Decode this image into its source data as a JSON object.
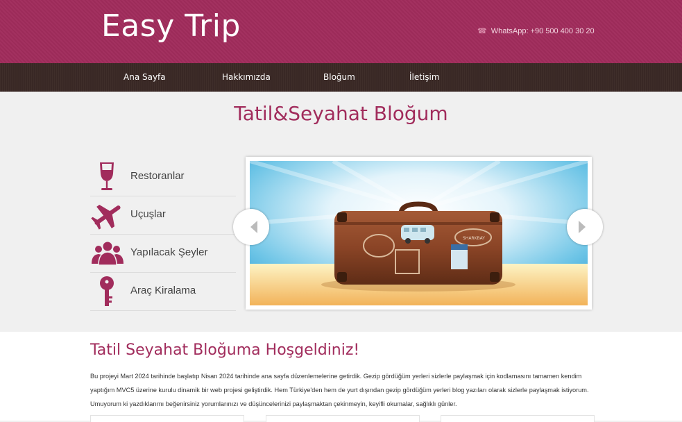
{
  "header": {
    "logo": "Easy Trip",
    "whatsapp_icon": "phone-icon",
    "whatsapp": "WhatsApp: +90 500 400 30 20"
  },
  "nav": {
    "items": [
      {
        "label": "Ana Sayfa"
      },
      {
        "label": "Hakkımızda"
      },
      {
        "label": "Bloğum"
      },
      {
        "label": "İletişim"
      }
    ]
  },
  "hero": {
    "title": "Tatil&Seyahat Bloğum"
  },
  "categories": [
    {
      "label": "Restoranlar",
      "icon": "wine-glass-icon"
    },
    {
      "label": "Uçuşlar",
      "icon": "airplane-icon"
    },
    {
      "label": "Yapılacak Şeyler",
      "icon": "people-icon"
    },
    {
      "label": "Araç Kiralama",
      "icon": "key-icon"
    }
  ],
  "slider": {
    "image": "vintage-suitcase-on-beach",
    "suitcase_sticker": "SHARKBAY",
    "prev_icon": "chevron-left-icon",
    "next_icon": "chevron-right-icon"
  },
  "welcome": {
    "title": "Tatil Seyahat Bloğuma Hoşgeldiniz!",
    "text": "Bu projeyi Mart 2024 tarihinde başlatıp Nisan 2024 tarihinde ana sayfa düzenlemelerine getirdik. Gezip gördüğüm yerleri sizlerle paylaşmak için kodlamasını tamamen kendim yaptığım MVC5 üzerine kurulu dinamik bir web projesi geliştirdik. Hem Türkiye'den hem de yurt dışından gezip gördüğüm yerleri blog yazıları olarak sizlerle paylaşmak istiyorum. Umuyorum ki yazdıklarımı beğenirsiniz yorumlarınızı ve düşüncelerinizi paylaşmaktan çekinmeyin, keyifli okumalar, sağlıklı günler."
  },
  "colors": {
    "brand": "#a12c5c",
    "nav_bg": "#3b2a26",
    "hero_bg": "#f0f0f0"
  }
}
